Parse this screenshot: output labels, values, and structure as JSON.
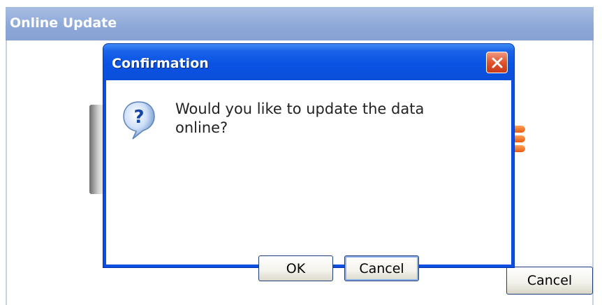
{
  "background_window": {
    "title": "Online Update",
    "cancel_label": "Cancel"
  },
  "dialog": {
    "title": "Confirmation",
    "message": "Would you like to update the data online?",
    "ok_label": "OK",
    "cancel_label": "Cancel",
    "icon": "question-icon",
    "close_icon": "close-icon"
  },
  "colors": {
    "dialog_titlebar": "#0a52e4",
    "background_titlebar": "#8ea9d8",
    "close_button": "#e0532d",
    "database_icon": "#f07020"
  }
}
